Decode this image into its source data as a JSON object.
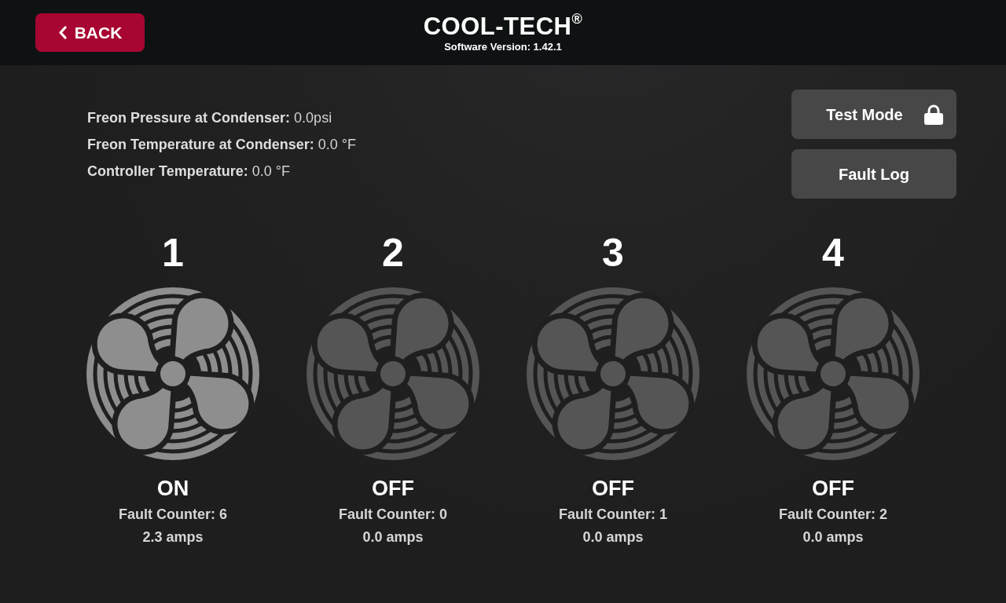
{
  "header": {
    "back_button": {
      "label": "BACK"
    },
    "brand": "COOL-TECH$^{®}$",
    "software_version": "Software Version: 1.42.1"
  },
  "readings": [
    {
      "label": "Freon Pressure at Condenser:",
      "value": "0.0psi"
    },
    {
      "label": "Freon Temperature at Condenser:",
      "value": "0.0 °F"
    },
    {
      "label": "Controller Temperature:",
      "value": "0.0 °F"
    }
  ],
  "buttons": [
    {
      "label": "Test Mode",
      "locked": true
    },
    {
      "label": "Fault Log",
      "locked": false
    }
  ],
  "fans": [
    {
      "number": "1",
      "on": true,
      "status": "ON",
      "fault_counter": "Fault Counter: 6",
      "current": "2.3 amps"
    },
    {
      "number": "2",
      "on": false,
      "status": "OFF",
      "fault_counter": "Fault Counter: 0",
      "current": "0.0 amps"
    },
    {
      "number": "3",
      "on": false,
      "status": "OFF",
      "fault_counter": "Fault Counter: 1",
      "current": "0.0 amps"
    },
    {
      "number": "4",
      "on": false,
      "status": "OFF",
      "fault_counter": "Fault Counter: 2",
      "current": "0.0 amps"
    }
  ]
}
